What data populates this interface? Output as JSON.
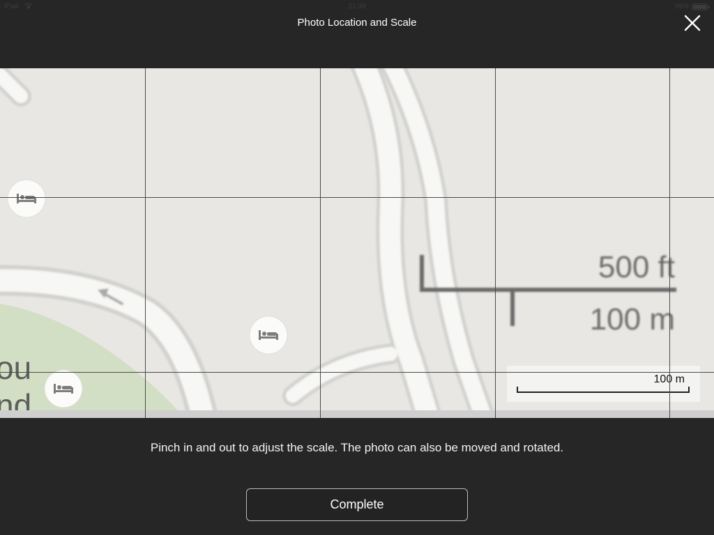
{
  "status_bar": {
    "device": "iPad",
    "time": "21:39",
    "battery": "99%"
  },
  "header": {
    "title": "Photo Location and Scale",
    "close_icon": "close-icon"
  },
  "map": {
    "photo_scale": {
      "top_label": "500 ft",
      "bottom_label": "100 m"
    },
    "map_scale_label": "100 m",
    "partial_labels": [
      "ou",
      "nd"
    ],
    "poi_icon": "bed-icon",
    "colors": {
      "land": "#e8e7e3",
      "road": "#f7f7f5",
      "park": "#d2dfc4",
      "grid": "#4a4a4a"
    }
  },
  "footer": {
    "instruction": "Pinch in and out to adjust the scale. The photo can also be moved and rotated.",
    "complete_label": "Complete"
  },
  "colors": {
    "background": "#262626",
    "button_border": "#bdbdbd"
  }
}
